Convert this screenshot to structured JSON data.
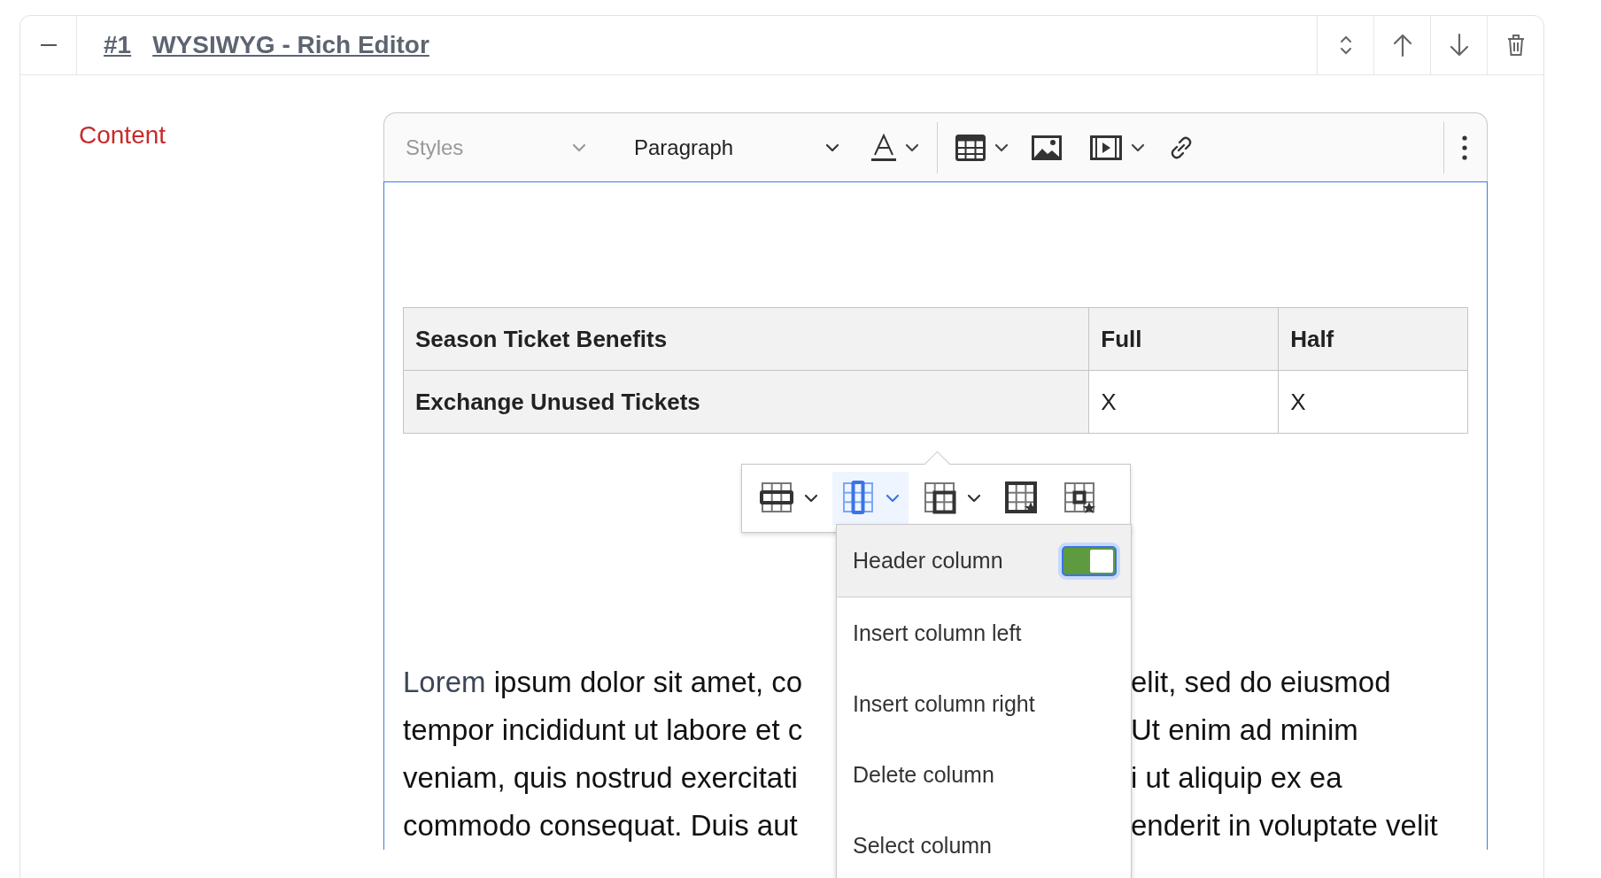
{
  "block": {
    "number": "#1",
    "title": "WYSIWYG - Rich Editor"
  },
  "field": {
    "label": "Content"
  },
  "toolbar": {
    "styles": {
      "placeholder": "Styles"
    },
    "heading": {
      "value": "Paragraph"
    }
  },
  "table": {
    "rows": [
      {
        "header": true,
        "cells": [
          "Season Ticket Benefits",
          "Full",
          "Half"
        ]
      },
      {
        "header": false,
        "cells": [
          "Exchange Unused Tickets",
          "X",
          "X"
        ]
      }
    ]
  },
  "table_toolbar": {
    "buttons": [
      {
        "kind": "row",
        "selected": false,
        "dropdown": true
      },
      {
        "kind": "column",
        "selected": true,
        "dropdown": true
      },
      {
        "kind": "merge",
        "selected": false,
        "dropdown": true
      },
      {
        "kind": "table_properties",
        "selected": false,
        "dropdown": false
      },
      {
        "kind": "cell_properties",
        "selected": false,
        "dropdown": false
      }
    ]
  },
  "column_menu": {
    "items": [
      {
        "kind": "switch",
        "label": "Header column",
        "on": true,
        "selected": true
      },
      {
        "kind": "action",
        "label": "Insert column left",
        "selected": false
      },
      {
        "kind": "action",
        "label": "Insert column right",
        "selected": false
      },
      {
        "kind": "action",
        "label": "Delete column",
        "selected": false
      },
      {
        "kind": "action",
        "label": "Select column",
        "selected": false
      }
    ]
  },
  "paragraph": {
    "lines": [
      {
        "left": [
          {
            "kind": "accent",
            "text": "Lorem"
          },
          {
            "kind": "plain",
            "text": " ipsum dolor sit amet, co"
          }
        ],
        "right": "elit, sed do eiusmod"
      },
      {
        "left": [
          {
            "kind": "plain",
            "text": "tempor incididunt ut labore et c"
          }
        ],
        "right": "Ut enim ad minim"
      },
      {
        "left": [
          {
            "kind": "plain",
            "text": "veniam, quis nostrud exercitati"
          }
        ],
        "right": "i ut aliquip ex ea"
      },
      {
        "left": [
          {
            "kind": "plain",
            "text": "commodo consequat. Duis aut"
          }
        ],
        "right": "enderit in voluptate velit"
      }
    ]
  }
}
